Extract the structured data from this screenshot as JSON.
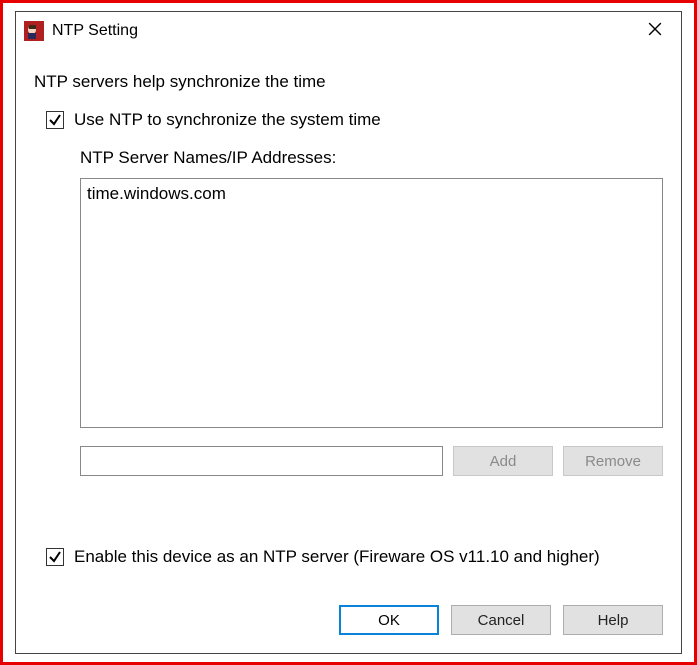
{
  "window": {
    "title": "NTP Setting"
  },
  "content": {
    "intro": "NTP servers help synchronize the time",
    "use_ntp_label": "Use NTP to synchronize the system time",
    "use_ntp_checked": true,
    "server_list_label": "NTP Server Names/IP Addresses:",
    "servers": [
      "time.windows.com"
    ],
    "server_input_value": "",
    "add_label": "Add",
    "remove_label": "Remove",
    "enable_server_label": "Enable this device as an NTP server (Fireware OS v11.10 and higher)",
    "enable_server_checked": true
  },
  "buttons": {
    "ok": "OK",
    "cancel": "Cancel",
    "help": "Help"
  }
}
